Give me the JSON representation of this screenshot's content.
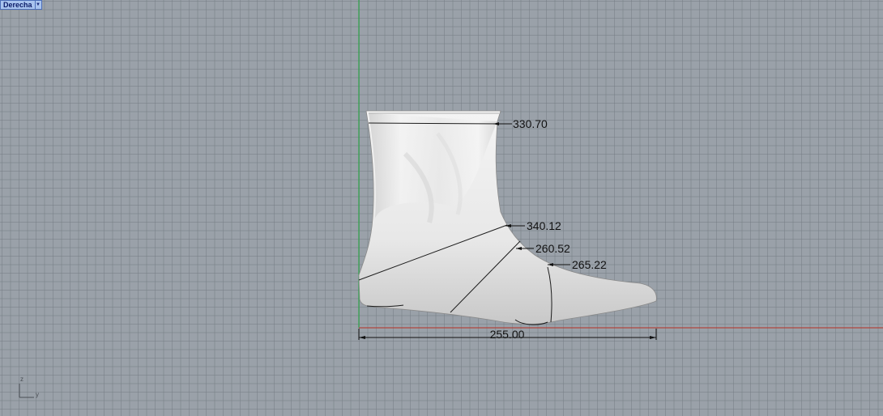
{
  "viewport": {
    "name": "Derecha"
  },
  "dimensions": {
    "top": "330.70",
    "instep": "340.12",
    "waist": "260.52",
    "ball": "265.22",
    "length": "255.00"
  },
  "axes": {
    "z": "z",
    "y": "y"
  },
  "colors": {
    "grid_background": "#9aa1a9",
    "x_axis": "#b0463f",
    "z_axis": "#2fa44a",
    "dimension_line": "#111111"
  }
}
